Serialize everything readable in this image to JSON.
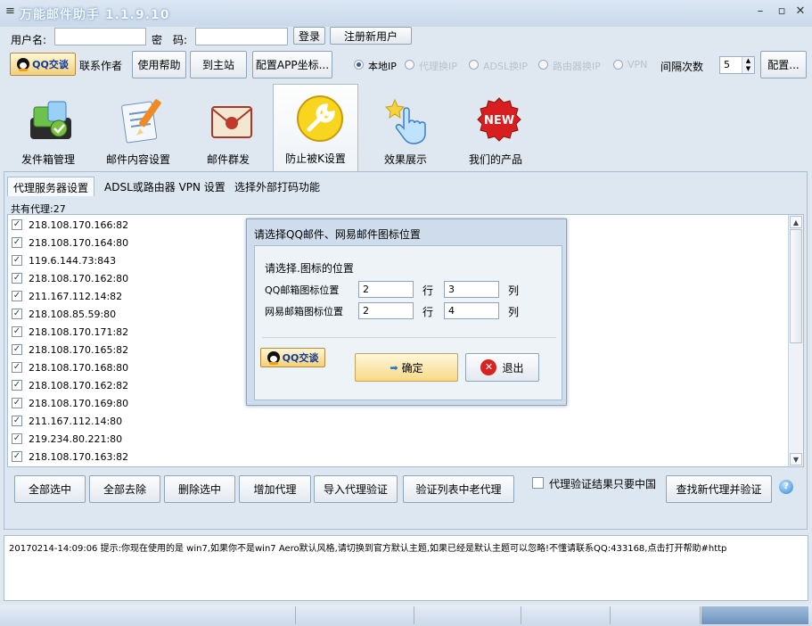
{
  "window": {
    "title": "万能邮件助手 1.1.9.10"
  },
  "login": {
    "username_label": "用户名:",
    "password_label": "密　码:",
    "login_button": "登录",
    "register_button": "注册新用户"
  },
  "row2": {
    "qq_button": "QQ交谈",
    "contact_label": "联系作者",
    "help_button": "使用帮助",
    "home_button": "到主站",
    "config_app_button": "配置APP坐标...",
    "ip_options": [
      {
        "label": "本地IP",
        "checked": true,
        "enabled": true
      },
      {
        "label": "代理换IP",
        "checked": false,
        "enabled": false
      },
      {
        "label": "ADSL换IP",
        "checked": false,
        "enabled": false
      },
      {
        "label": "路由器换IP",
        "checked": false,
        "enabled": false
      },
      {
        "label": "VPN",
        "checked": false,
        "enabled": false
      }
    ],
    "interval_label": "间隔次数",
    "interval_value": "5",
    "config_button": "配置..."
  },
  "toolbar": [
    {
      "label": "发件箱管理",
      "icon": "outbox-icon"
    },
    {
      "label": "邮件内容设置",
      "icon": "mail-content-icon"
    },
    {
      "label": "邮件群发",
      "icon": "mass-mail-icon"
    },
    {
      "label": "防止被K设置",
      "icon": "wrench-icon",
      "active": true
    },
    {
      "label": "效果展示",
      "icon": "pointer-hand-icon"
    },
    {
      "label": "我们的产品",
      "icon": "new-badge-icon",
      "badge": "NEW"
    }
  ],
  "tabs": [
    {
      "label": "代理服务器设置",
      "active": true
    },
    {
      "label": "ADSL或路由器 VPN 设置"
    },
    {
      "label": "选择外部打码功能"
    }
  ],
  "proxy": {
    "count_label": "共有代理:27",
    "items": [
      "218.108.170.166:82",
      "218.108.170.164:80",
      "119.6.144.73:843",
      "218.108.170.162:80",
      "211.167.112.14:82",
      "218.108.85.59:80",
      "218.108.170.171:82",
      "218.108.170.165:82",
      "218.108.170.168:80",
      "218.108.170.162:82",
      "218.108.170.169:80",
      "211.167.112.14:80",
      "219.234.80.221:80",
      "218.108.170.163:82"
    ]
  },
  "bottom_buttons": {
    "select_all": "全部选中",
    "deselect_all": "全部去除",
    "delete_selected": "删除选中",
    "add_proxy": "增加代理",
    "import_verify": "导入代理验证",
    "verify_old": "验证列表中老代理",
    "china_only_label": "代理验证结果只要中国",
    "find_new": "查找新代理并验证"
  },
  "log": {
    "line": "20170214-14:09:06  提示:你现在使用的是 win7,如果你不是win7 Aero默认风格,请切换到官方默认主题,如果已经是默认主题可以忽略!不懂请联系QQ:433168,点击打开帮助#http"
  },
  "dialog": {
    "title": "请选择QQ邮件、网易邮件图标位置",
    "heading": "请选择.图标的位置",
    "qq_label": "QQ邮箱图标位置",
    "qq_row": "2",
    "qq_col": "3",
    "netease_label": "网易邮箱图标位置",
    "netease_row": "2",
    "netease_col": "4",
    "row_unit": "行",
    "col_unit": "列",
    "qq_button": "QQ交谈",
    "ok_button": "确定",
    "exit_button": "退出"
  }
}
